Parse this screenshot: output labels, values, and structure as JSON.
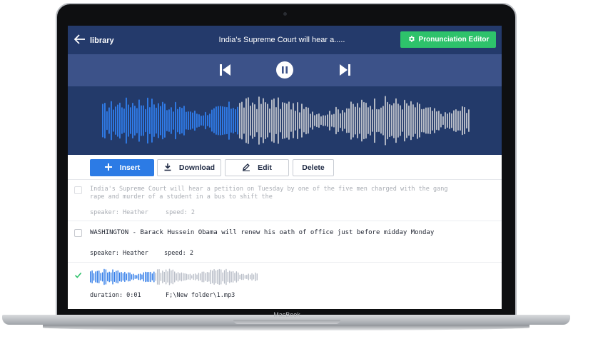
{
  "device": {
    "brand": "MacBook"
  },
  "header": {
    "back_label": "library",
    "title": "India's Supreme Court will hear a.....",
    "pronunciation_button": "Pronunciation Editor"
  },
  "player": {
    "state": "playing",
    "progress": 0.37
  },
  "toolbar": {
    "insert_label": "Insert",
    "download_label": "Download",
    "edit_label": "Edit",
    "delete_label": "Delete"
  },
  "items": [
    {
      "text": "India's Supreme Court will hear a petition on Tuesday by one of the five men charged with the gang rape and murder of a student in a bus to shift the",
      "speaker": "speaker: Heather",
      "speed": "speed: 2",
      "checked": false,
      "disabled": true
    },
    {
      "text": "WASHINGTON - Barack Hussein Obama will renew his oath of office just before midday Monday",
      "speaker": "speaker: Heather",
      "speed": "speed: 2",
      "checked": false,
      "disabled": false
    },
    {
      "duration": "duration: 0:01",
      "path": "F;\\New folder\\1.mp3",
      "checked": true,
      "progress": 0.38
    }
  ],
  "colors": {
    "header_bg": "#243a6b",
    "controls_bg": "#3c5289",
    "wave_played": "#2f7be8",
    "wave_unplayed": "#b9bec8",
    "accent_green": "#2ec26b",
    "primary_blue": "#2c7be5"
  },
  "icons": {
    "back": "arrow-left-icon",
    "pronunciation": "gear-icon",
    "prev": "skip-back-icon",
    "pause": "pause-icon",
    "next": "skip-forward-icon",
    "insert": "plus-icon",
    "download": "download-icon",
    "edit": "pencil-icon",
    "checked": "checkmark-icon"
  }
}
